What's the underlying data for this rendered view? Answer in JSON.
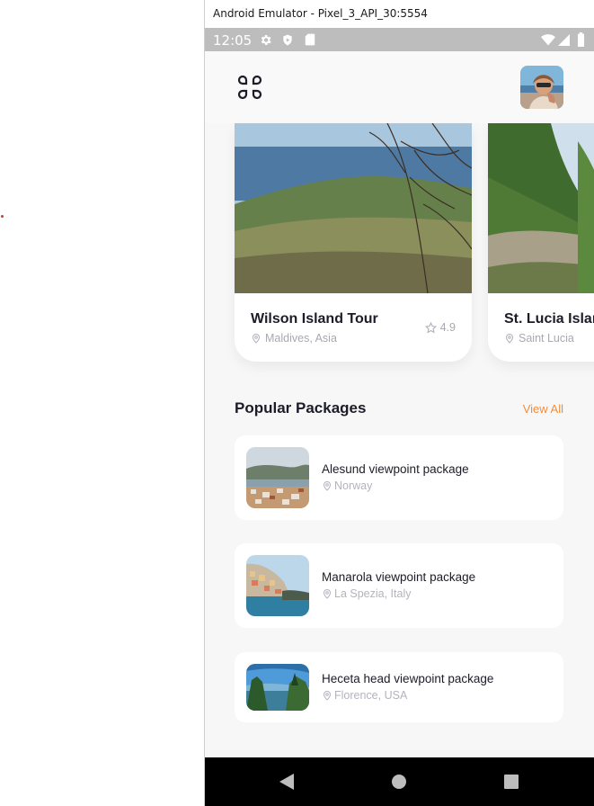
{
  "window": {
    "title": "Android Emulator - Pixel_3_API_30:5554"
  },
  "statusbar": {
    "time": "12:05",
    "left_icons": [
      "gear-icon",
      "shield-icon",
      "sd-card-icon"
    ],
    "right_icons": [
      "wifi-icon",
      "signal-icon",
      "battery-icon"
    ]
  },
  "header": {
    "menu_icon": "grid-menu-icon",
    "avatar": "profile-avatar"
  },
  "tours": [
    {
      "title": "Wilson Island Tour",
      "location": "Maldives, Asia",
      "rating": "4.9"
    },
    {
      "title": "St. Lucia Island",
      "location": "Saint Lucia"
    }
  ],
  "popular": {
    "title": "Popular Packages",
    "view_all": "View All",
    "items": [
      {
        "title": "Alesund viewpoint package",
        "location": "Norway"
      },
      {
        "title": "Manarola viewpoint package",
        "location": "La Spezia, Italy"
      },
      {
        "title": "Heceta head viewpoint package",
        "location": "Florence, USA"
      }
    ]
  },
  "navbar": {
    "buttons": [
      "back-icon",
      "home-icon",
      "recents-icon"
    ]
  },
  "colors": {
    "accent": "#f28d3b",
    "title_text": "#1c1c28",
    "muted_text": "#a8a8b3",
    "status_bar": "#bdbdbd"
  }
}
